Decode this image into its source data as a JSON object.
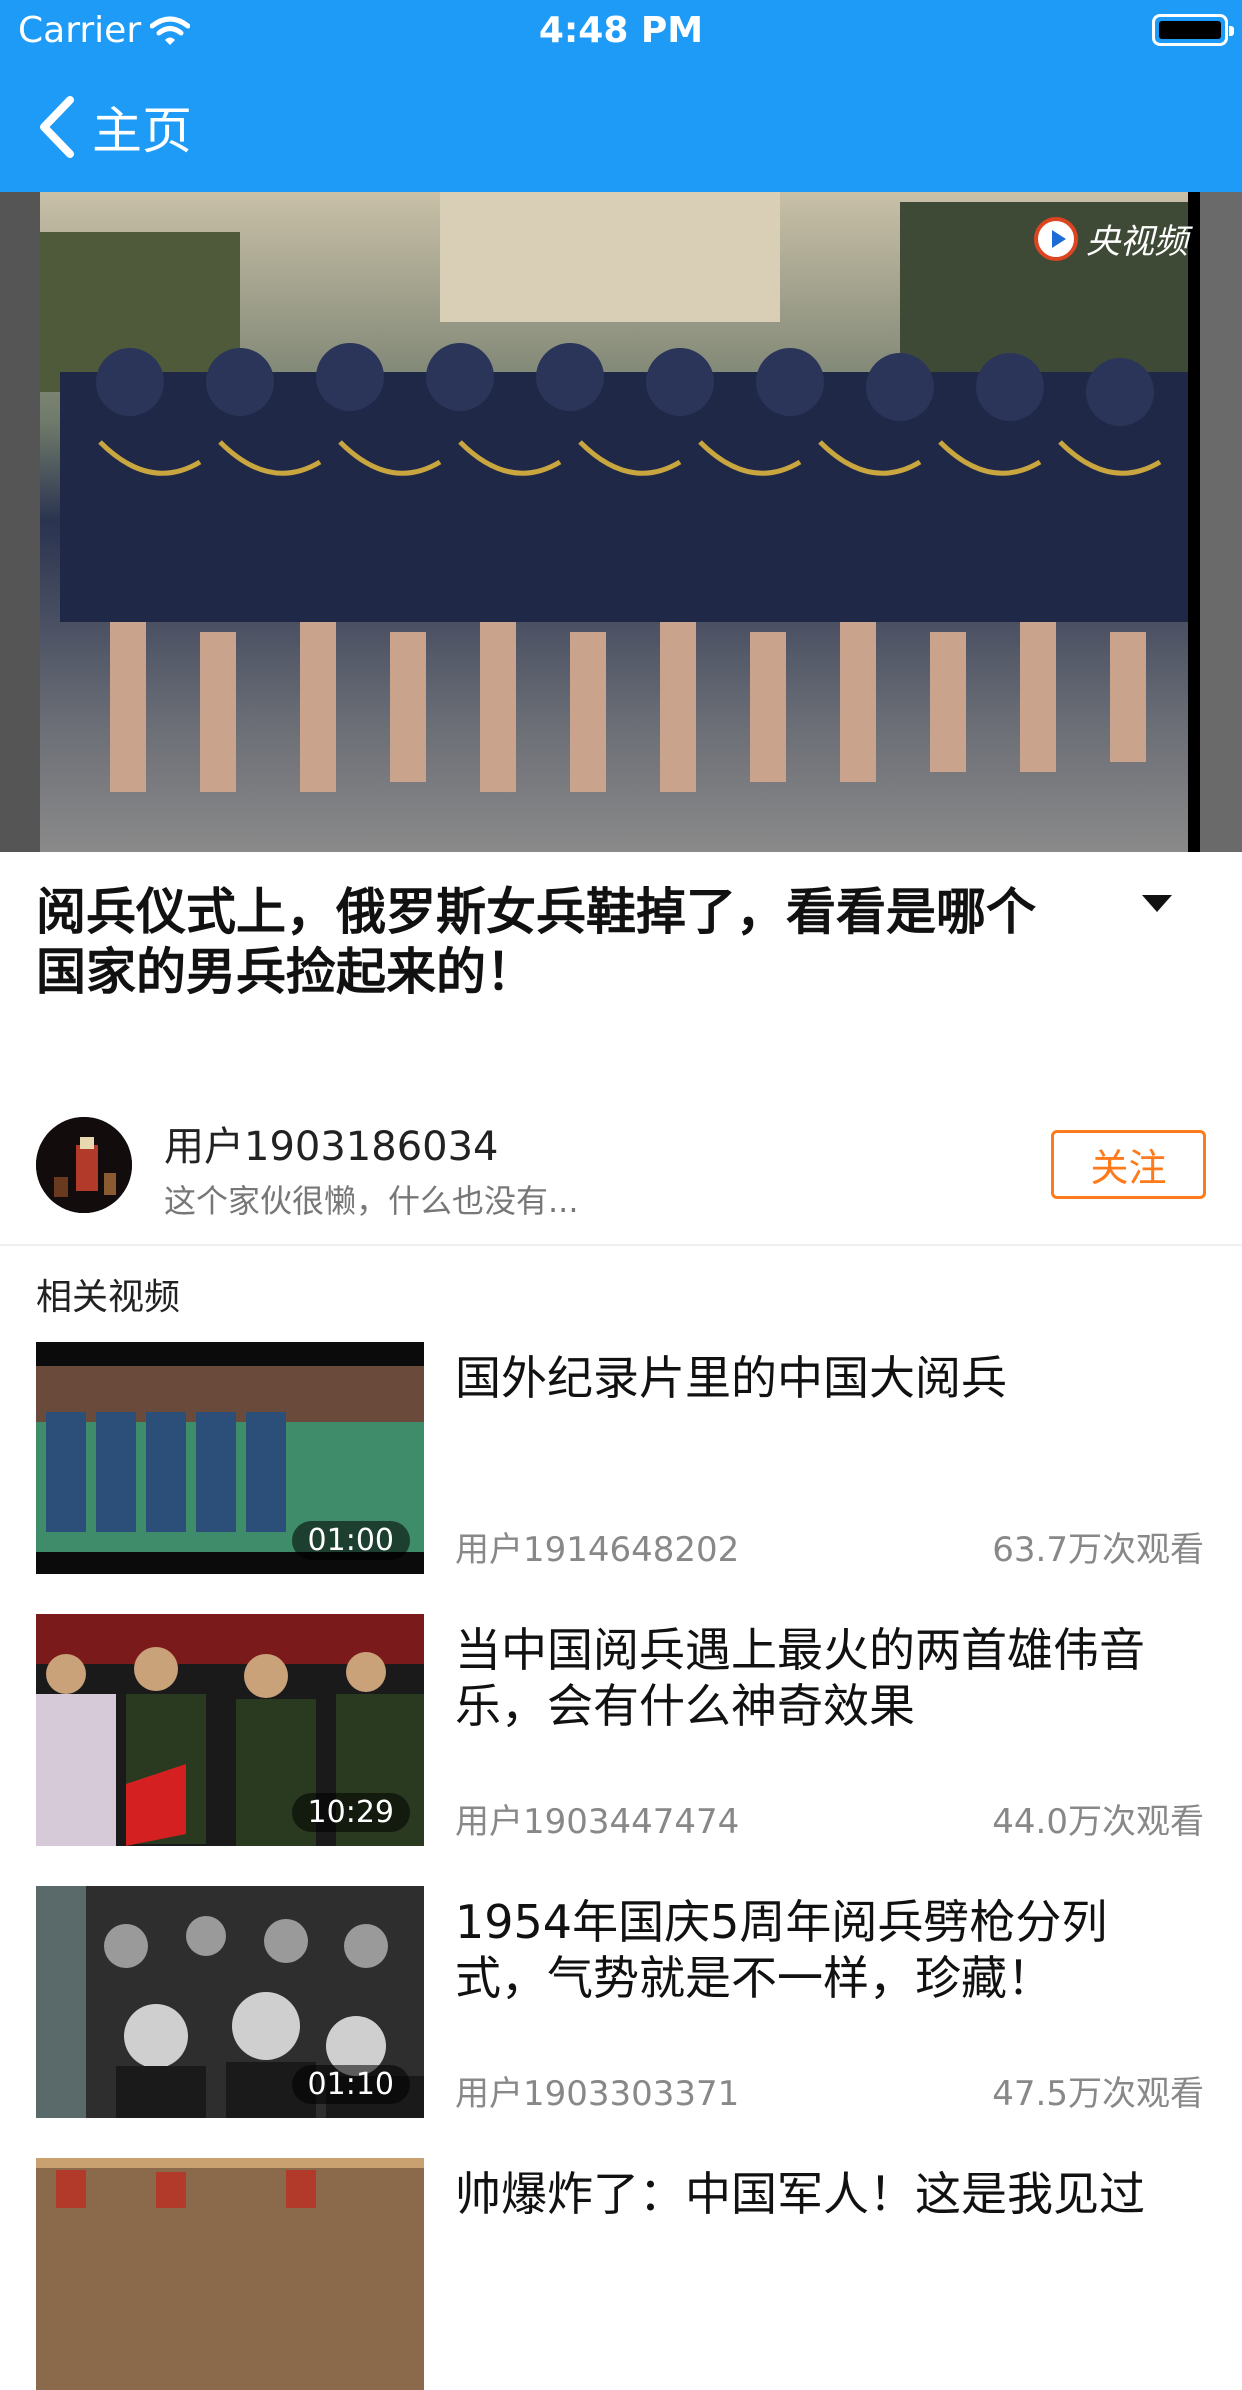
{
  "status_bar": {
    "carrier": "Carrier",
    "time": "4:48 PM"
  },
  "nav": {
    "back_label": "主页"
  },
  "video": {
    "watermark": "央视频"
  },
  "title": "阅兵仪式上，俄罗斯女兵鞋掉了，看看是哪个国家的男兵捡起来的！",
  "author": {
    "name": "用户1903186034",
    "bio": "这个家伙很懒，什么也没有...",
    "follow_label": "关注"
  },
  "related": {
    "section_title": "相关视频",
    "items": [
      {
        "title": "国外纪录片里的中国大阅兵",
        "duration": "01:00",
        "author": "用户1914648202",
        "views": "63.7万次观看"
      },
      {
        "title": "当中国阅兵遇上最火的两首雄伟音乐，会有什么神奇效果",
        "duration": "10:29",
        "author": "用户1903447474",
        "views": "44.0万次观看"
      },
      {
        "title": "1954年国庆5周年阅兵劈枪分列式，气势就是不一样，珍藏！",
        "duration": "01:10",
        "author": "用户1903303371",
        "views": "47.5万次观看"
      },
      {
        "title": "帅爆炸了：中国军人！这是我见过"
      }
    ]
  },
  "colors": {
    "header": "#1e9bf6",
    "follow": "#ff7a1a",
    "accent_text": "#888888"
  }
}
